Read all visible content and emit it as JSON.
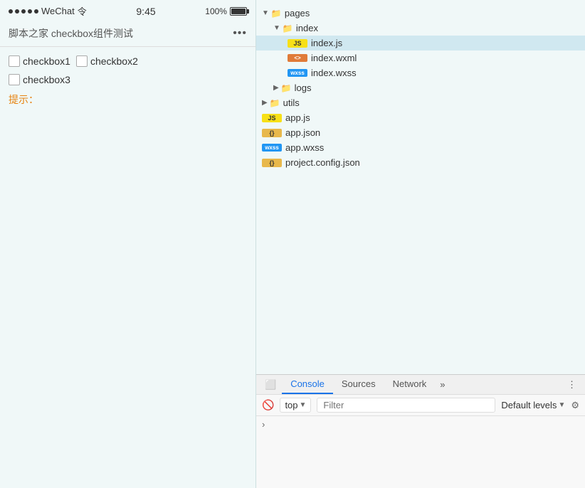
{
  "phone": {
    "status": {
      "dots_count": 5,
      "app_name": "WeChat",
      "wifi_symbol": "令",
      "time": "9:45",
      "battery_percent": "100%"
    },
    "nav": {
      "title": "脚本之家 checkbox组件测试",
      "more": "•••"
    },
    "checkboxes": [
      {
        "label": "checkbox1"
      },
      {
        "label": "checkbox2"
      },
      {
        "label": "checkbox3"
      }
    ],
    "hint": "提示："
  },
  "filetree": {
    "items": [
      {
        "id": "pages",
        "label": "pages",
        "type": "folder",
        "indent": 0,
        "expanded": true,
        "arrow": "▼"
      },
      {
        "id": "index-folder",
        "label": "index",
        "type": "folder",
        "indent": 1,
        "expanded": true,
        "arrow": "▼"
      },
      {
        "id": "index-js",
        "label": "index.js",
        "type": "js",
        "indent": 2,
        "active": true
      },
      {
        "id": "index-wxml",
        "label": "index.wxml",
        "type": "xml",
        "indent": 2
      },
      {
        "id": "index-wxss",
        "label": "index.wxss",
        "type": "wxss",
        "indent": 2
      },
      {
        "id": "logs-folder",
        "label": "logs",
        "type": "folder",
        "indent": 1,
        "expanded": false,
        "arrow": "▶"
      },
      {
        "id": "utils-folder",
        "label": "utils",
        "type": "folder",
        "indent": 0,
        "expanded": false,
        "arrow": "▶"
      },
      {
        "id": "app-js",
        "label": "app.js",
        "type": "js",
        "indent": 0
      },
      {
        "id": "app-json",
        "label": "app.json",
        "type": "json",
        "indent": 0
      },
      {
        "id": "app-wxss",
        "label": "app.wxss",
        "type": "wxss",
        "indent": 0
      },
      {
        "id": "project-config",
        "label": "project.config.json",
        "type": "json",
        "indent": 0
      }
    ]
  },
  "console": {
    "tabs": [
      {
        "id": "console",
        "label": "Console",
        "active": true
      },
      {
        "id": "sources",
        "label": "Sources",
        "active": false
      },
      {
        "id": "network",
        "label": "Network",
        "active": false
      }
    ],
    "more_label": "»",
    "toolbar": {
      "top_label": "top",
      "filter_placeholder": "Filter",
      "default_levels": "Default levels"
    }
  }
}
